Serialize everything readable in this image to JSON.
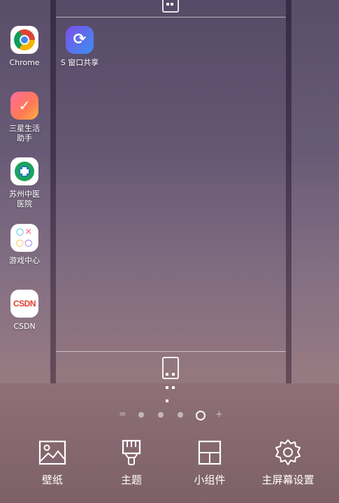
{
  "apps_left": [
    {
      "label": "Chrome",
      "icon": "chrome-icon"
    },
    {
      "label": "三星生活\n助手",
      "icon": "samsung-assistant-icon"
    },
    {
      "label": "苏州中医\n医院",
      "icon": "hospital-icon"
    },
    {
      "label": "游戏中心",
      "icon": "game-center-icon"
    },
    {
      "label": "CSDN",
      "icon": "csdn-icon"
    }
  ],
  "csdn_logo": "CSDN",
  "page_app": {
    "label": "S 窗口共享",
    "icon": "s-window-share-icon"
  },
  "indicator": {
    "left_symbol": "=",
    "right_symbol": "+",
    "pages": 4,
    "current_page": 4
  },
  "toolbar": {
    "wallpaper": "壁纸",
    "themes": "主题",
    "widgets": "小组件",
    "home_settings": "主屏幕设置"
  },
  "colors": {
    "chrome_red": "#db4437",
    "chrome_yellow": "#f4b400",
    "chrome_green": "#0f9d58",
    "chrome_blue": "#4285f4",
    "csdn_red": "#e23c2d"
  }
}
